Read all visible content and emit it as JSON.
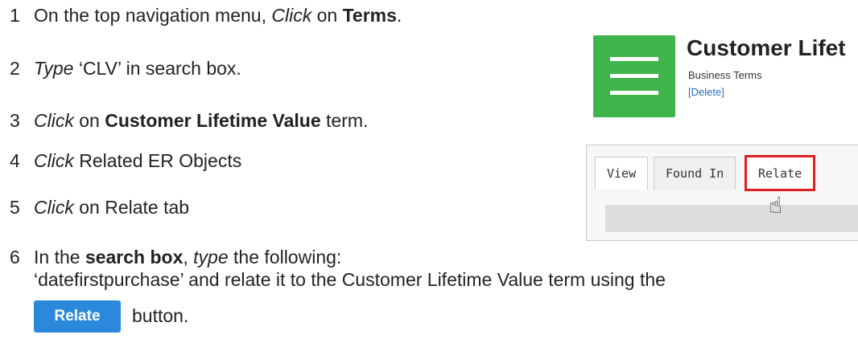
{
  "steps": [
    {
      "num": "1",
      "pre": "On the top navigation menu, ",
      "em": "Click",
      "mid": " on ",
      "bold": "Terms",
      "post": "."
    },
    {
      "num": "2",
      "em": "Type",
      "post": " ‘CLV’ in search box."
    },
    {
      "num": "3",
      "em": "Click",
      "mid": " on ",
      "bold": "Customer Lifetime Value",
      "post": " term."
    },
    {
      "num": "4",
      "em": "Click",
      "post": " Related ER Objects"
    },
    {
      "num": "5",
      "em": "Click",
      "post": " on Relate tab"
    },
    {
      "num": "6",
      "pre": "In the ",
      "bold": "search box",
      "mid": ", ",
      "em": "type",
      "post": " the following:",
      "line2": "‘datefirstpurchase’ and relate it to the Customer Lifetime Value term using the"
    }
  ],
  "relate_button": {
    "label": "Relate",
    "suffix": "button."
  },
  "screenshot": {
    "title": "Customer Lifet",
    "subtitle": "Business Terms",
    "delete_link": "[Delete]",
    "tabs": [
      "View",
      "Found In",
      "Relate"
    ],
    "highlight_color": "#e02020",
    "logo_color": "#3db54a"
  }
}
